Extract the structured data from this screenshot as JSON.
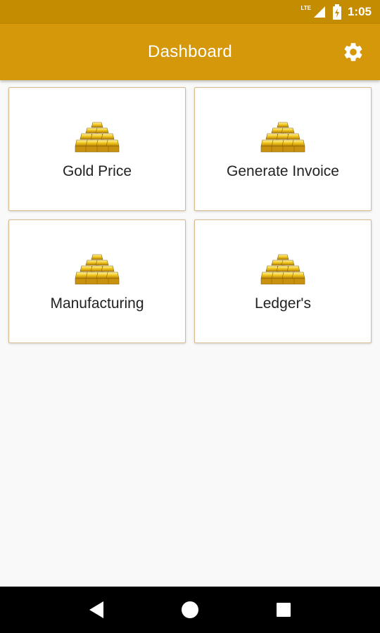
{
  "status_bar": {
    "network": "LTE",
    "time": "1:05"
  },
  "app_bar": {
    "title": "Dashboard",
    "settings_icon": "gear-icon"
  },
  "cards": [
    {
      "label": "Gold Price",
      "icon": "gold-bars-icon"
    },
    {
      "label": "Generate Invoice",
      "icon": "gold-bars-icon"
    },
    {
      "label": "Manufacturing",
      "icon": "gold-bars-icon"
    },
    {
      "label": "Ledger's",
      "icon": "gold-bars-icon"
    }
  ],
  "nav_bar": {
    "back_icon": "back-triangle-icon",
    "home_icon": "home-circle-icon",
    "recents_icon": "recents-square-icon"
  },
  "colors": {
    "status_bar": "#c48c00",
    "app_bar": "#d4980a",
    "card_border": "#d8b88c"
  }
}
